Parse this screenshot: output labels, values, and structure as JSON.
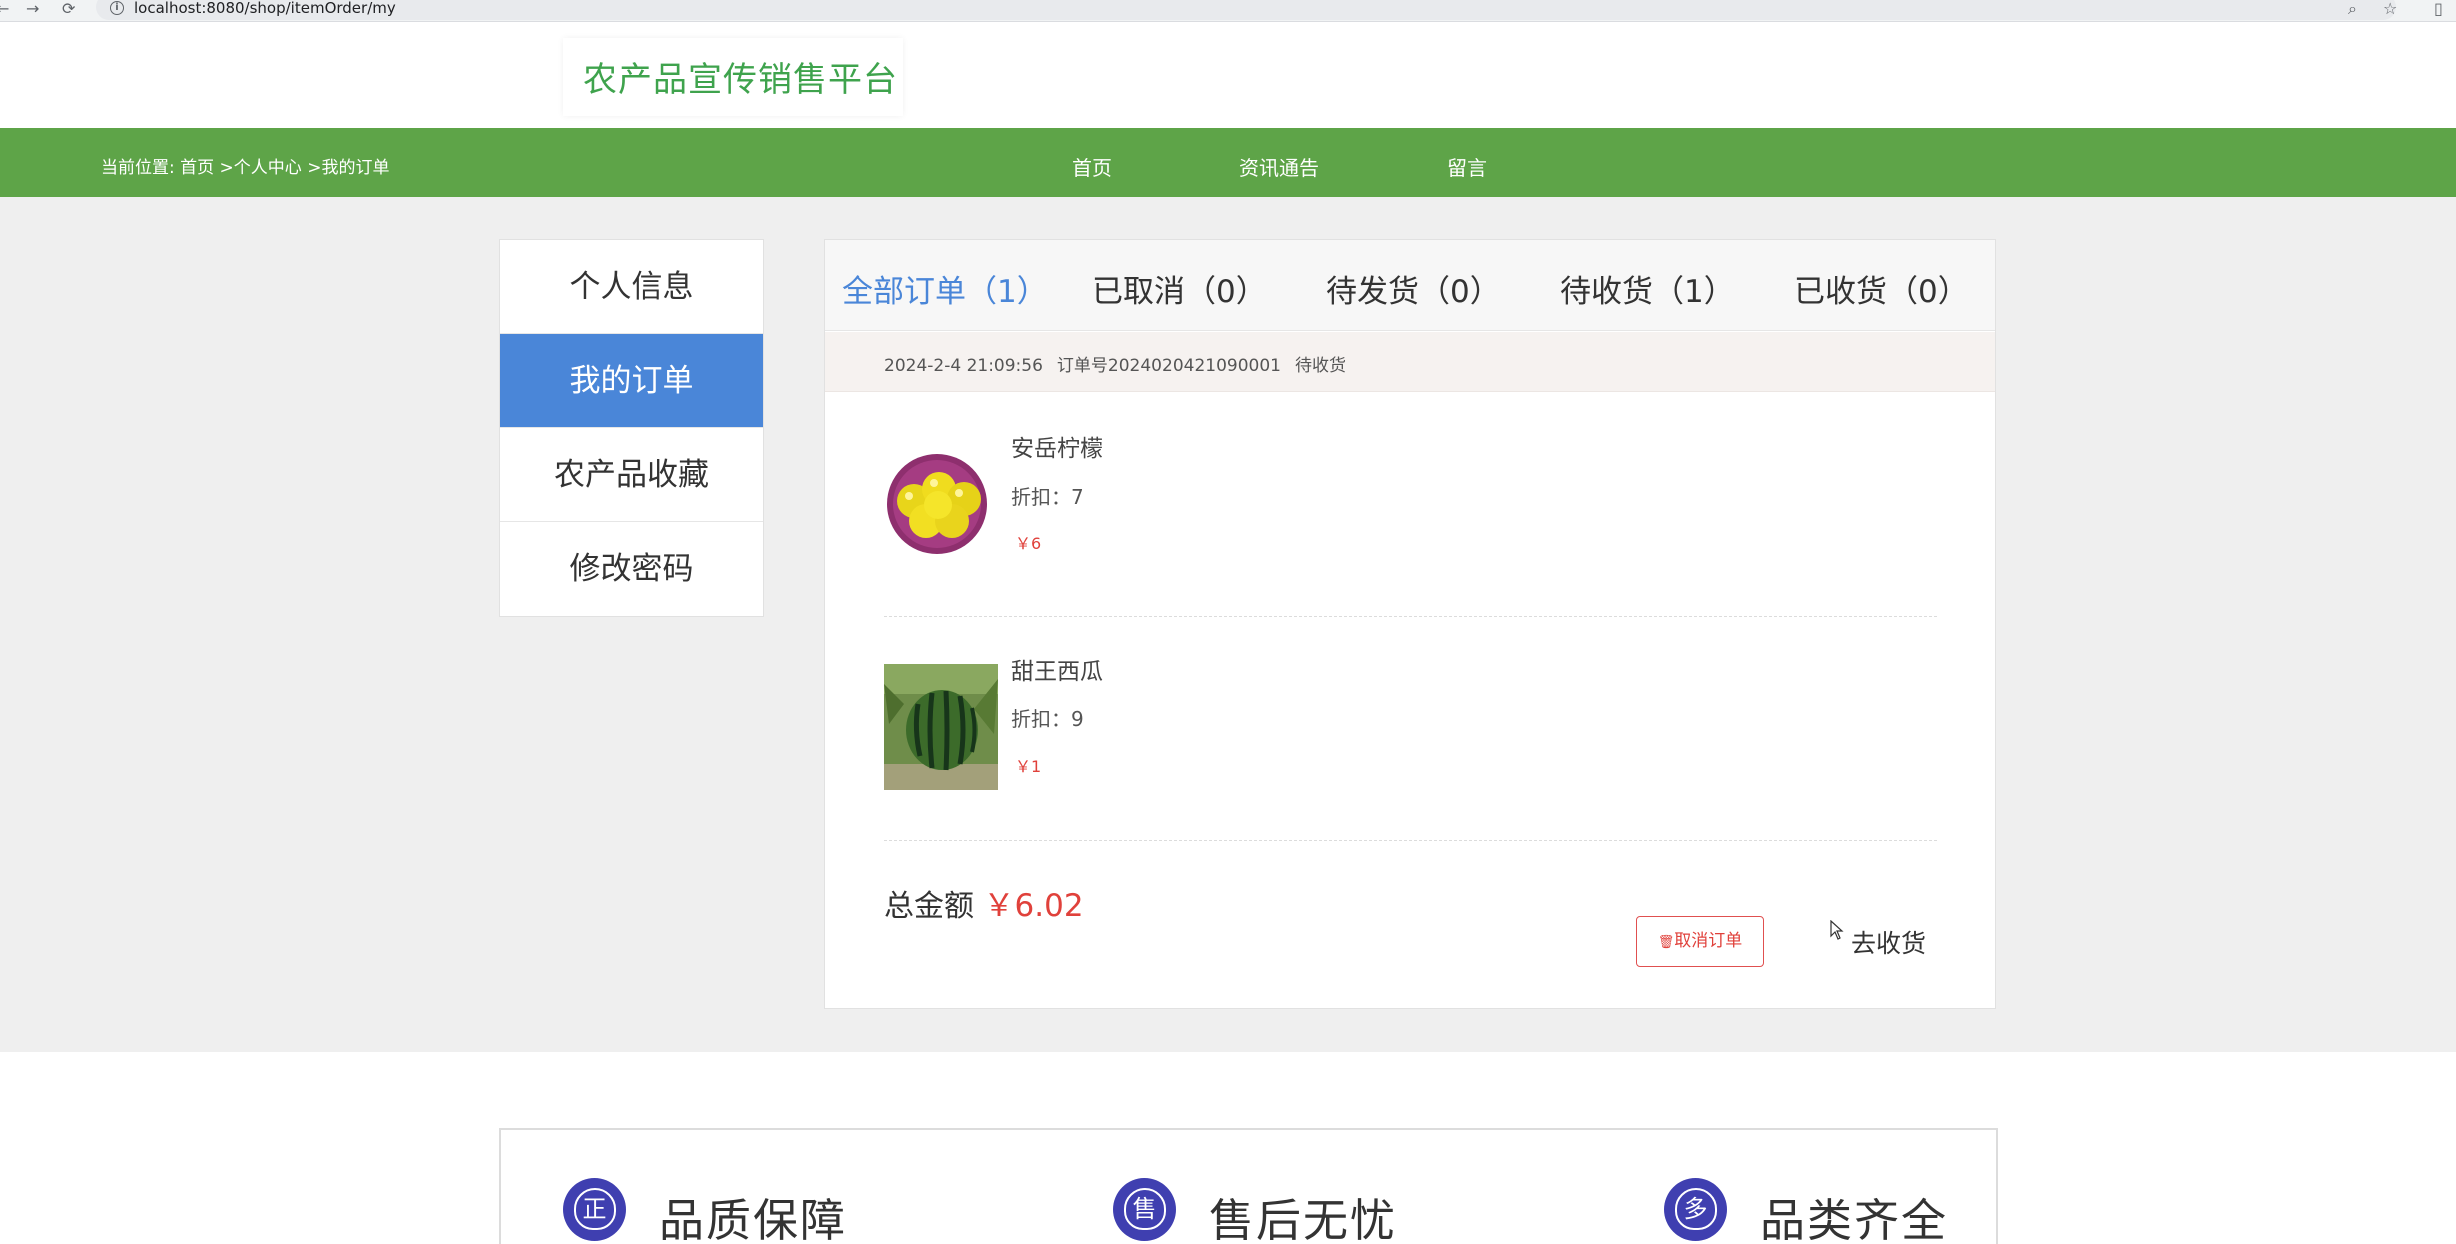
{
  "browser": {
    "back": "←",
    "forward": "→",
    "reload": "⟳",
    "info": "i",
    "url": "localhost:8080/shop/itemOrder/my",
    "zoom_icon": "⌕",
    "star_icon": "☆",
    "panel_icon": "▯"
  },
  "header": {
    "logo": "农产品宣传销售平台"
  },
  "nav": {
    "breadcrumb_prefix": "当前位置: ",
    "breadcrumb_home": "首页",
    "breadcrumb_sep1": " >",
    "breadcrumb_center": "个人中心",
    "breadcrumb_sep2": " >",
    "breadcrumb_current": "我的订单",
    "links": [
      "首页",
      "资讯通告",
      "留言"
    ]
  },
  "sidebar": {
    "items": [
      {
        "label": "个人信息"
      },
      {
        "label": "我的订单"
      },
      {
        "label": "农产品收藏"
      },
      {
        "label": "修改密码"
      }
    ]
  },
  "tabs": [
    {
      "label": "全部订单（1）"
    },
    {
      "label": "已取消（0）"
    },
    {
      "label": "待发货（0）"
    },
    {
      "label": "待收货（1）"
    },
    {
      "label": "已收货（0）"
    }
  ],
  "order": {
    "time": "2024-2-4 21:09:56",
    "number": "订单号2024020421090001",
    "status": "待收货",
    "items": [
      {
        "name": "安岳柠檬",
        "discount": "折扣：7",
        "price": "￥6"
      },
      {
        "name": "甜王西瓜",
        "discount": "折扣：9",
        "price": "￥1"
      }
    ],
    "total_label": "总金额",
    "total_amount": "￥6.02",
    "cancel_icon": "🗑",
    "cancel_label": "取消订单",
    "receive_label": "去收货"
  },
  "features": [
    {
      "icon_char": "正",
      "label": "品质保障"
    },
    {
      "icon_char": "售",
      "label": "售后无忧"
    },
    {
      "icon_char": "多",
      "label": "品类齐全"
    }
  ],
  "colors": {
    "green_nav": "#5ea448",
    "active_blue": "#4a86d8",
    "price_red": "#e0413b",
    "logo_green": "#3fa34d",
    "feature_icon": "#3f3fb0"
  }
}
